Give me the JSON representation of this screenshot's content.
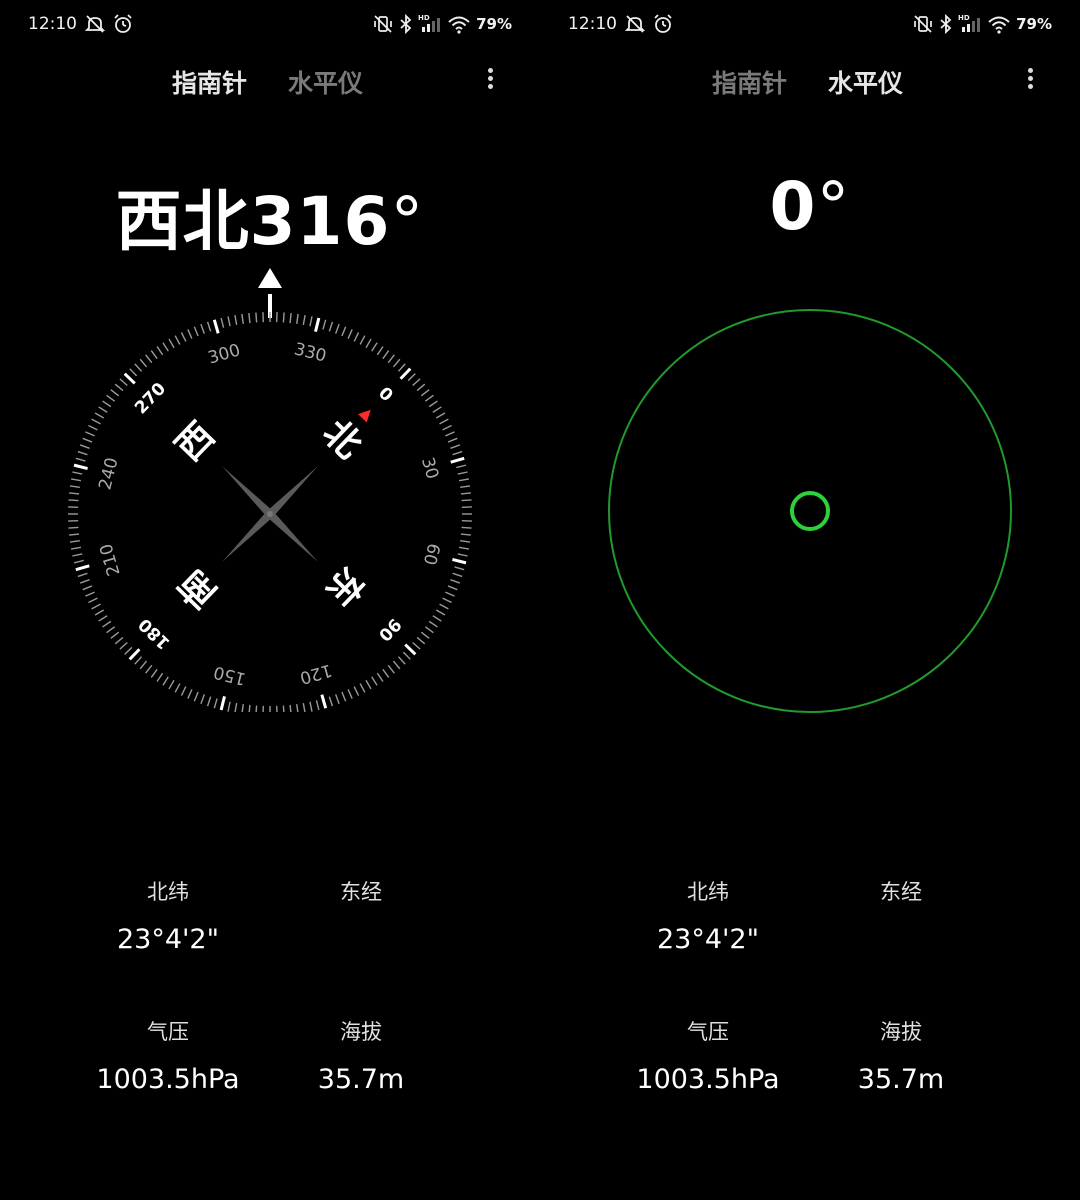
{
  "status_bar": {
    "time": "12:10",
    "battery": "79%",
    "icons": [
      "mute-icon",
      "alarm-icon",
      "vibrate-icon",
      "bluetooth-icon",
      "signal-icon",
      "wifi-icon"
    ],
    "hd_label": "HD"
  },
  "left_screen": {
    "tabs": [
      {
        "label": "指南针",
        "active": true
      },
      {
        "label": "水平仪",
        "active": false
      }
    ],
    "heading": {
      "direction": "西北",
      "degrees": "316",
      "unit": "°"
    },
    "compass": {
      "heading_degrees": 316,
      "cardinals": {
        "north": "北",
        "east": "东",
        "south": "南",
        "west": "西"
      },
      "degree_labels": [
        "0",
        "30",
        "60",
        "90",
        "120",
        "150",
        "180",
        "210",
        "240",
        "270",
        "300",
        "330"
      ],
      "north_marker_color": "#ff2a2a"
    },
    "info": {
      "latitude_label": "北纬",
      "latitude_value": "23°4'2\"",
      "longitude_label": "东经",
      "longitude_value": "",
      "pressure_label": "气压",
      "pressure_value": "1003.5hPa",
      "altitude_label": "海拔",
      "altitude_value": "35.7m"
    }
  },
  "right_screen": {
    "tabs": [
      {
        "label": "指南针",
        "active": false
      },
      {
        "label": "水平仪",
        "active": true
      }
    ],
    "heading": {
      "degrees": "0",
      "unit": "°"
    },
    "level": {
      "accent_color": "#2bd23a",
      "ring_color": "#1f9a2c"
    },
    "info": {
      "latitude_label": "北纬",
      "latitude_value": "23°4'2\"",
      "longitude_label": "东经",
      "longitude_value": "",
      "pressure_label": "气压",
      "pressure_value": "1003.5hPa",
      "altitude_label": "海拔",
      "altitude_value": "35.7m"
    }
  }
}
